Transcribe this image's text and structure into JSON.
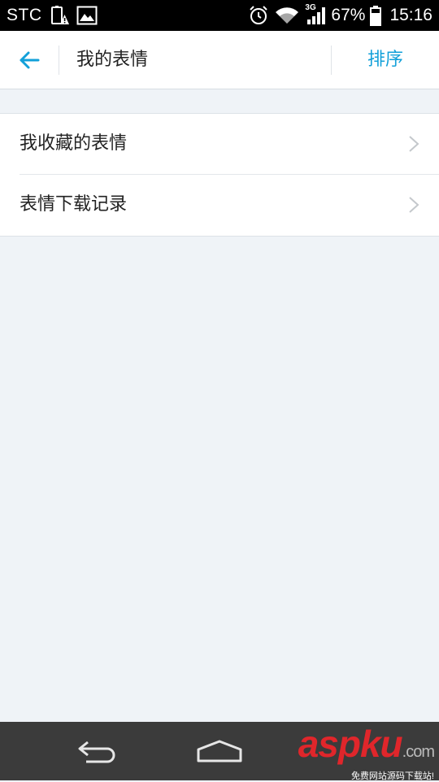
{
  "status_bar": {
    "carrier": "STC",
    "network": "3G",
    "battery_percent": "67%",
    "time": "15:16"
  },
  "header": {
    "title": "我的表情",
    "action_label": "排序"
  },
  "list": {
    "items": [
      {
        "label": "我收藏的表情"
      },
      {
        "label": "表情下载记录"
      }
    ]
  },
  "watermark": {
    "main": "aspku",
    "suffix": ".com",
    "sub": "免费网站源码下载站!"
  },
  "colors": {
    "accent": "#12a0d9",
    "background": "#eff3f7",
    "navbar": "#3b3b3b",
    "watermark": "#e0262b"
  },
  "icons": [
    "warning-icon",
    "image-icon",
    "alarm-icon",
    "wifi-icon",
    "signal-icon",
    "battery-icon",
    "back-arrow-icon",
    "chevron-right-icon",
    "nav-back-icon",
    "nav-home-icon"
  ]
}
